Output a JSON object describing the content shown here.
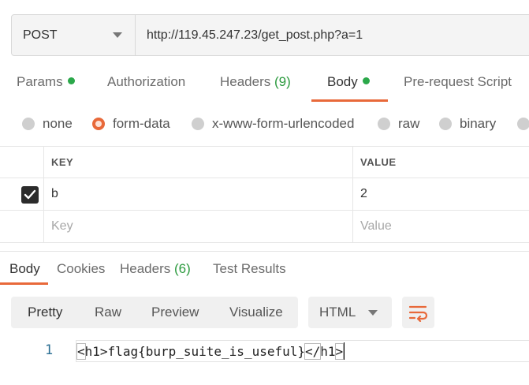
{
  "request": {
    "method": "POST",
    "url": "http://119.45.247.23/get_post.php?a=1"
  },
  "request_tabs": [
    {
      "label": "Params",
      "count": "",
      "dot": true,
      "active": false
    },
    {
      "label": "Authorization",
      "count": "",
      "dot": false,
      "active": false
    },
    {
      "label": "Headers",
      "count": "(9)",
      "dot": false,
      "active": false
    },
    {
      "label": "Body",
      "count": "",
      "dot": true,
      "active": true
    },
    {
      "label": "Pre-request Script",
      "count": "",
      "dot": false,
      "active": false
    }
  ],
  "body_types": [
    {
      "label": "none",
      "checked": false
    },
    {
      "label": "form-data",
      "checked": true
    },
    {
      "label": "x-www-form-urlencoded",
      "checked": false
    },
    {
      "label": "raw",
      "checked": false
    },
    {
      "label": "binary",
      "checked": false
    }
  ],
  "params_table": {
    "headers": [
      "KEY",
      "VALUE"
    ],
    "rows": [
      {
        "checked": true,
        "key": "b",
        "value": "2"
      }
    ],
    "placeholder": {
      "key": "Key",
      "value": "Value"
    }
  },
  "response_tabs": [
    {
      "label": "Body",
      "count": "",
      "active": true
    },
    {
      "label": "Cookies",
      "count": "",
      "active": false
    },
    {
      "label": "Headers",
      "count": "(6)",
      "active": false
    },
    {
      "label": "Test Results",
      "count": "",
      "active": false
    }
  ],
  "view_modes": [
    "Pretty",
    "Raw",
    "Preview",
    "Visualize"
  ],
  "active_view": "Pretty",
  "language": "HTML",
  "code": {
    "line_number": "1",
    "open_bracket": "<",
    "open_tag": "h1",
    "close_bracket": ">",
    "content": "flag{burp_suite_is_useful}",
    "close_tag_open": "</",
    "close_tag": "h1",
    "close_tag_end": ">"
  },
  "colors": {
    "accent": "#e8693a",
    "status_green": "#2ba84a",
    "line_number": "#2b6f93"
  },
  "icons": [
    "caret-down-icon",
    "check-icon",
    "wrap-lines-icon"
  ]
}
